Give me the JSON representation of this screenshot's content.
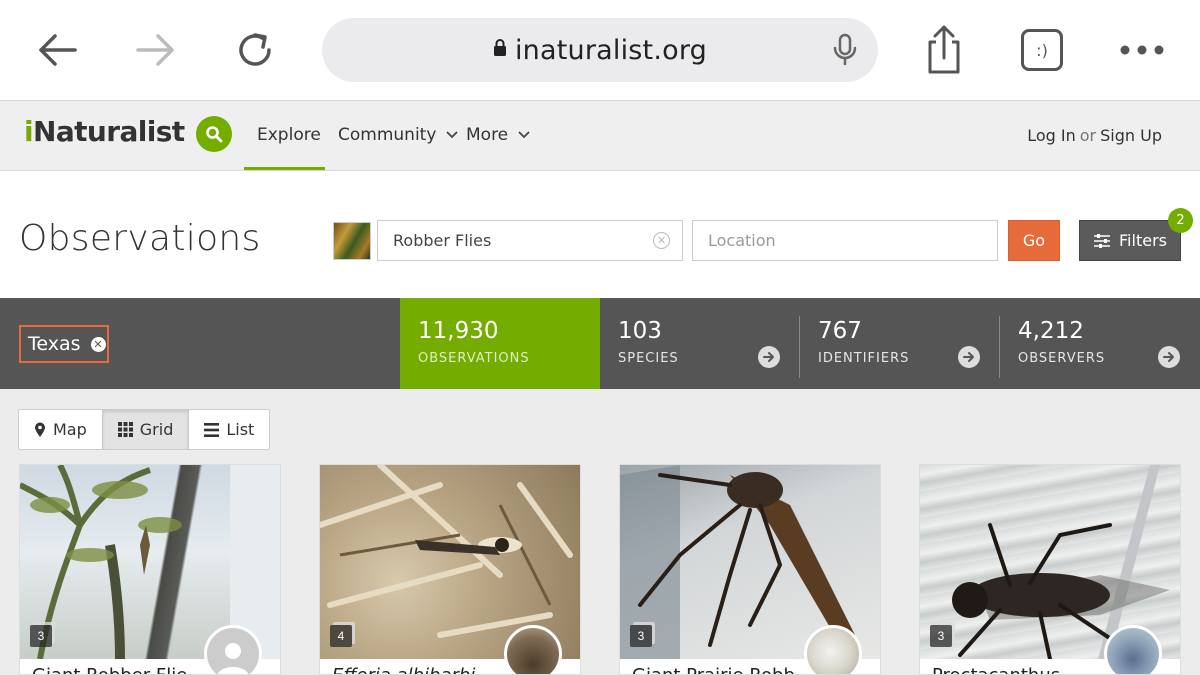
{
  "browser": {
    "url": "inaturalist.org",
    "back_icon": "back-arrow-icon",
    "forward_icon": "forward-arrow-icon",
    "reload_icon": "reload-icon",
    "share_icon": "share-icon",
    "tabs_icon": "tabs-icon",
    "tabs_label": ":)",
    "more_icon": "more-icon"
  },
  "header": {
    "logo_leaf": "i",
    "logo_rest": "Naturalist",
    "nav": {
      "explore": "Explore",
      "community": "Community",
      "more": "More"
    },
    "auth": {
      "login": "Log In",
      "or": "or",
      "signup": "Sign Up"
    }
  },
  "page": {
    "title": "Observations",
    "search": {
      "taxon_value": "Robber Flies",
      "location_placeholder": "Location",
      "go_label": "Go",
      "filters_label": "Filters",
      "filters_count": "2"
    }
  },
  "stats": {
    "place": "Texas",
    "items": [
      {
        "value": "11,930",
        "label": "OBSERVATIONS"
      },
      {
        "value": "103",
        "label": "SPECIES"
      },
      {
        "value": "767",
        "label": "IDENTIFIERS"
      },
      {
        "value": "4,212",
        "label": "OBSERVERS"
      }
    ]
  },
  "views": {
    "map": "Map",
    "grid": "Grid",
    "list": "List",
    "active": "grid"
  },
  "cards": [
    {
      "photo_count": "3",
      "title": "Giant Robber Flie"
    },
    {
      "photo_count": "4",
      "title": "Efferia albibarbi"
    },
    {
      "photo_count": "3",
      "title": "Giant Prairie Robb"
    },
    {
      "photo_count": "3",
      "title": "Proctacanthus"
    }
  ],
  "colors": {
    "brand_green": "#74ac00",
    "accent_orange": "#e56b3a",
    "stats_bar": "#555555"
  }
}
